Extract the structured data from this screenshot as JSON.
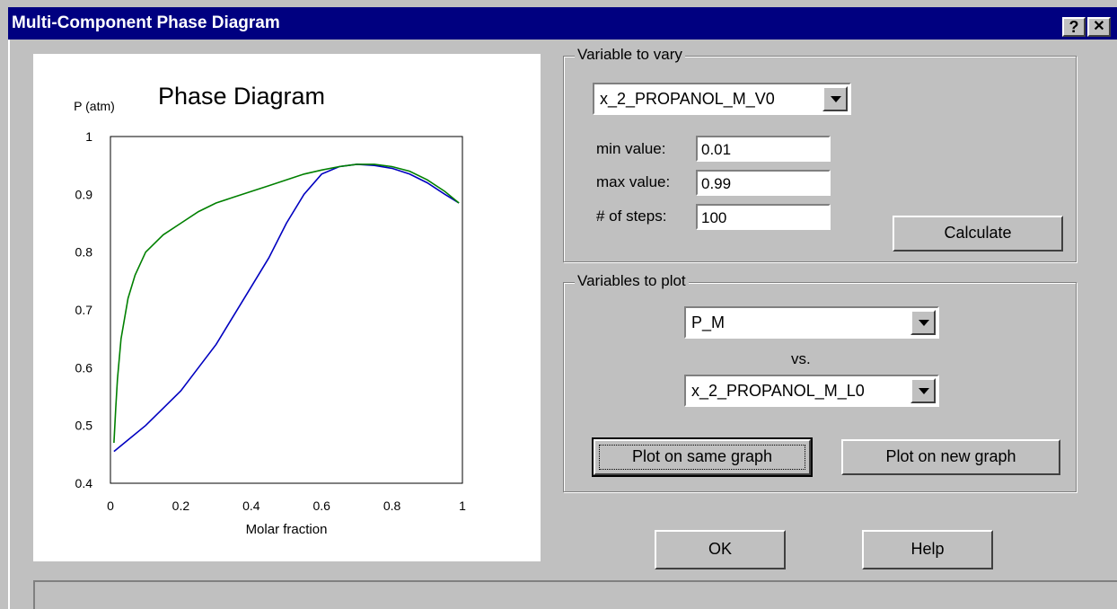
{
  "window": {
    "title": "Multi-Component Phase Diagram",
    "help_glyph": "?",
    "close_glyph": "✕"
  },
  "vary": {
    "group_label": "Variable to vary",
    "variable": "x_2_PROPANOL_M_V0",
    "min_label": "min value:",
    "min_value": "0.01",
    "max_label": "max value:",
    "max_value": "0.99",
    "steps_label": "# of steps:",
    "steps_value": "100",
    "calculate_label": "Calculate"
  },
  "plot": {
    "group_label": "Variables to plot",
    "y_variable": "P_M",
    "vs_label": "vs.",
    "x_variable": "x_2_PROPANOL_M_L0",
    "same_graph_label": "Plot on same graph",
    "new_graph_label": "Plot on new graph"
  },
  "footer": {
    "ok_label": "OK",
    "help_label": "Help"
  },
  "chart_data": {
    "type": "line",
    "title": "Phase Diagram",
    "xlabel": "Molar fraction",
    "ylabel": "P (atm)",
    "xlim": [
      0,
      1
    ],
    "ylim": [
      0.4,
      1
    ],
    "x_ticks": [
      "0",
      "0.2",
      "0.4",
      "0.6",
      "0.8",
      "1"
    ],
    "y_ticks": [
      "0.4",
      "0.5",
      "0.6",
      "0.7",
      "0.8",
      "0.9",
      "1"
    ],
    "grid": false,
    "series": [
      {
        "color": "#0000c0",
        "x": [
          0.01,
          0.05,
          0.1,
          0.15,
          0.2,
          0.25,
          0.3,
          0.35,
          0.4,
          0.45,
          0.5,
          0.55,
          0.6,
          0.65,
          0.7,
          0.75,
          0.8,
          0.85,
          0.9,
          0.95,
          0.99
        ],
        "y": [
          0.455,
          0.475,
          0.5,
          0.53,
          0.56,
          0.6,
          0.64,
          0.69,
          0.74,
          0.79,
          0.85,
          0.9,
          0.935,
          0.948,
          0.952,
          0.95,
          0.945,
          0.935,
          0.92,
          0.9,
          0.885
        ]
      },
      {
        "color": "#008000",
        "x": [
          0.01,
          0.015,
          0.02,
          0.03,
          0.05,
          0.07,
          0.1,
          0.15,
          0.2,
          0.25,
          0.3,
          0.35,
          0.4,
          0.45,
          0.5,
          0.55,
          0.6,
          0.65,
          0.7,
          0.75,
          0.8,
          0.85,
          0.9,
          0.95,
          0.99
        ],
        "y": [
          0.47,
          0.53,
          0.58,
          0.65,
          0.72,
          0.76,
          0.8,
          0.83,
          0.85,
          0.87,
          0.885,
          0.895,
          0.905,
          0.915,
          0.925,
          0.935,
          0.942,
          0.948,
          0.952,
          0.952,
          0.948,
          0.94,
          0.925,
          0.905,
          0.885
        ]
      }
    ]
  }
}
